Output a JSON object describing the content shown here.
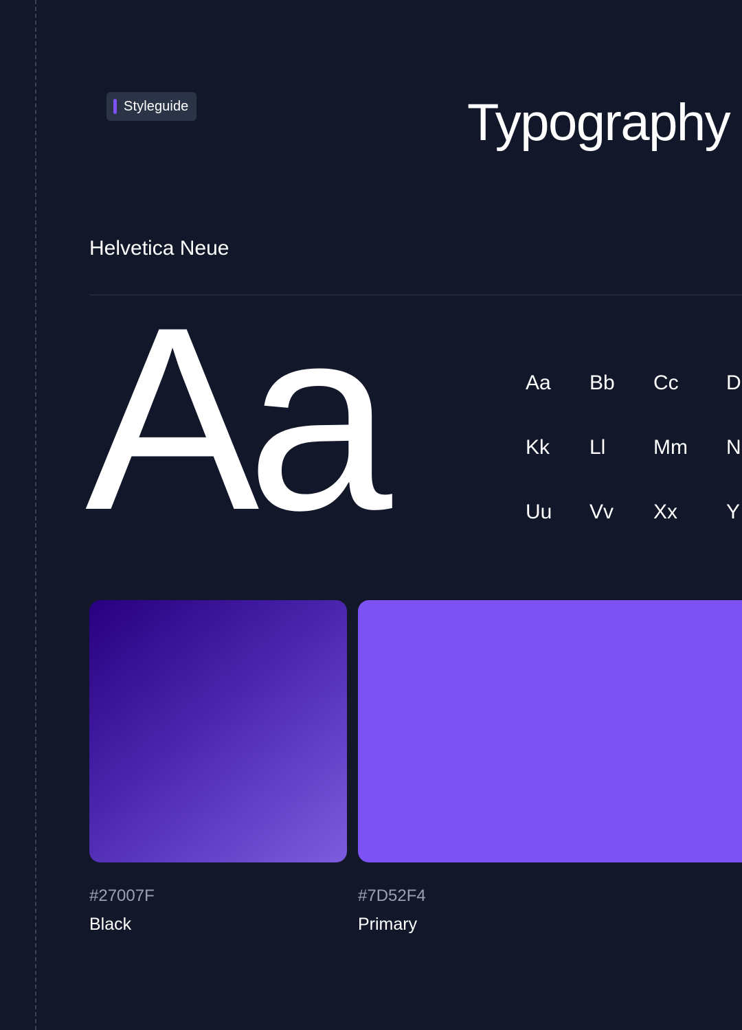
{
  "badge": {
    "label": "Styleguide",
    "accent": "#7D52F4"
  },
  "page_title": "Typography a",
  "font": {
    "name": "Helvetica Neue",
    "sample": "Aa"
  },
  "alphabet": [
    [
      "Aa",
      "Bb",
      "Cc",
      "D"
    ],
    [
      "Kk",
      "Ll",
      "Mm",
      "N"
    ],
    [
      "Uu",
      "Vv",
      "Xx",
      "Y"
    ]
  ],
  "colors": [
    {
      "hex": "#27007F",
      "name": "Black"
    },
    {
      "hex": "#7D52F4",
      "name": "Primary"
    }
  ],
  "theme": {
    "background": "#121829",
    "badge_bg": "#2B3346",
    "muted_text": "#9AA1B0"
  }
}
